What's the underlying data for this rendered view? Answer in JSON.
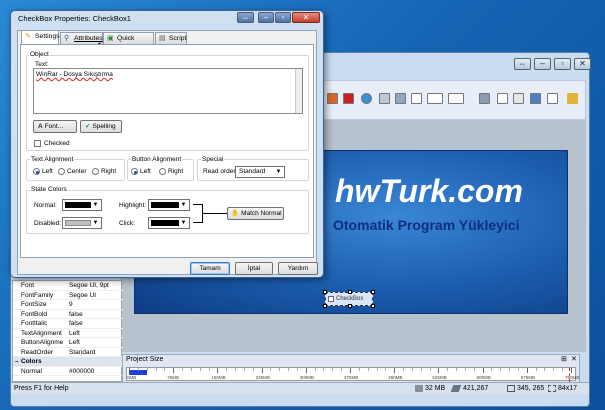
{
  "dialog": {
    "title": "CheckBox Properties: CheckBox1",
    "tabs": [
      {
        "label": "Settings",
        "icon": "pencil-icon"
      },
      {
        "label": "Attributes",
        "icon": "wand-icon"
      },
      {
        "label": "Quick Action",
        "icon": "action-icon"
      },
      {
        "label": "Script",
        "icon": "script-icon"
      }
    ],
    "object_group": "Object",
    "text_label": "Text:",
    "text_value": "WinRar - Dosya Sıkıştırma",
    "font_button": "Font...",
    "spelling_button": "Spelling",
    "checked_label": "Checked",
    "text_alignment": {
      "title": "Text Alignment",
      "options": [
        "Left",
        "Center",
        "Right"
      ],
      "selected": "Left"
    },
    "button_alignment": {
      "title": "Button Alignment",
      "options": [
        "Left",
        "Right"
      ],
      "selected": "Left"
    },
    "special": {
      "title": "Special",
      "read_order_label": "Read order:",
      "read_order_value": "Standard"
    },
    "state_colors": {
      "title": "State Colors",
      "normal_label": "Normal:",
      "disabled_label": "Disabled:",
      "highlight_label": "Highlight:",
      "click_label": "Click:",
      "normal_color": "#000000",
      "disabled_color": "#c0c0c0",
      "highlight_color": "#000000",
      "click_color": "#000000",
      "match_normal_button": "Match Normal"
    },
    "ok_button": "Tamam",
    "cancel_button": "İptal",
    "help_button": "Yardım"
  },
  "banner": {
    "title": "hwTurk.com",
    "subtitle": "Otomatik Program Yükleyici"
  },
  "canvas_checkbox_label": "CheckBox",
  "properties": {
    "rows": [
      {
        "key": "Font",
        "value": "Segoe UI, 9pt"
      },
      {
        "key": "FontFamily",
        "value": "Segoe UI"
      },
      {
        "key": "FontSize",
        "value": "9"
      },
      {
        "key": "FontBold",
        "value": "false"
      },
      {
        "key": "FontItalic",
        "value": "false"
      },
      {
        "key": "TextAlignment",
        "value": "Left"
      },
      {
        "key": "ButtonAlignme",
        "value": "Left"
      },
      {
        "key": "ReadOrder",
        "value": "Standard"
      }
    ],
    "section_label": "Colors",
    "partial_row": {
      "key": "Normal",
      "value": "#000000"
    }
  },
  "project_size": {
    "title": "Project Size",
    "ruler_labels": [
      "0MB",
      "75MB",
      "150MB",
      "225MB",
      "300MB",
      "375MB",
      "450MB",
      "525MB",
      "600MB",
      "675MB",
      "750MB"
    ],
    "used_fraction": 0.04
  },
  "status": {
    "help": "Press F1 for Help",
    "size": "32 MB",
    "position": "421,267",
    "coords": "345, 265",
    "dims": "84x17"
  },
  "colors": {
    "accent": "#1b4f9c",
    "banner_title": "#ffffff",
    "banner_subtitle": "#0e2f80"
  }
}
